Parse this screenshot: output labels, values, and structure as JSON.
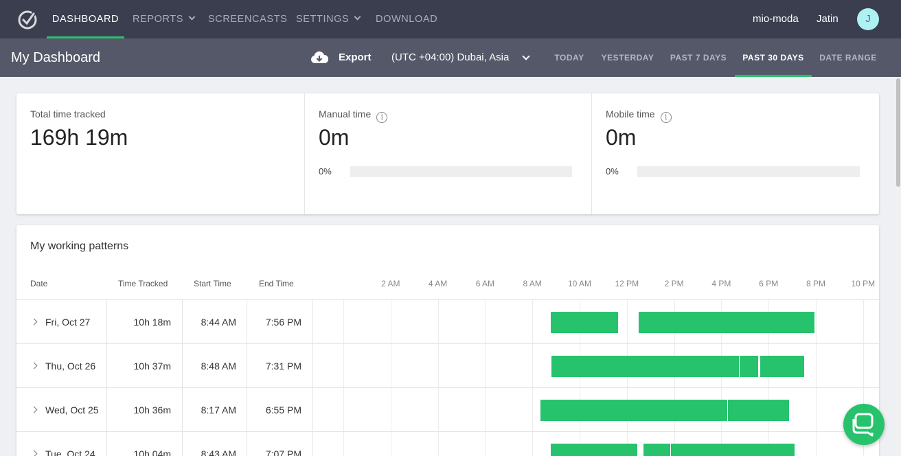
{
  "nav": {
    "items": [
      {
        "label": "DASHBOARD",
        "active": true,
        "dropdown": false
      },
      {
        "label": "REPORTS",
        "active": false,
        "dropdown": true
      },
      {
        "label": "SCREENCASTS",
        "active": false,
        "dropdown": false
      },
      {
        "label": "SETTINGS",
        "active": false,
        "dropdown": true
      },
      {
        "label": "DOWNLOAD",
        "active": false,
        "dropdown": false
      }
    ],
    "workspace": "mio-moda",
    "user": "Jatin",
    "avatar_initial": "J"
  },
  "subheader": {
    "title": "My Dashboard",
    "export_label": "Export",
    "timezone": "(UTC +04:00) Dubai, Asia",
    "ranges": [
      "TODAY",
      "YESTERDAY",
      "PAST 7 DAYS",
      "PAST 30 DAYS",
      "DATE RANGE"
    ],
    "active_range": "PAST 30 DAYS"
  },
  "stats": {
    "total": {
      "label": "Total time tracked",
      "value": "169h 19m"
    },
    "manual": {
      "label": "Manual time",
      "value": "0m",
      "percent_label": "0%",
      "percent": 0
    },
    "mobile": {
      "label": "Mobile time",
      "value": "0m",
      "percent_label": "0%",
      "percent": 0
    }
  },
  "patterns": {
    "title": "My working patterns",
    "columns": {
      "date": "Date",
      "tracked": "Time Tracked",
      "start": "Start Time",
      "end": "End Time"
    },
    "hour_labels": [
      "2 AM",
      "4 AM",
      "6 AM",
      "8 AM",
      "10 AM",
      "12 PM",
      "2 PM",
      "4 PM",
      "6 PM",
      "8 PM",
      "10 PM"
    ],
    "rows": [
      {
        "date": "Fri, Oct 27",
        "tracked": "10h 18m",
        "start": "8:44 AM",
        "end": "7:56 PM",
        "segments": [
          [
            8.77,
            11.63
          ],
          [
            12.5,
            19.93
          ]
        ]
      },
      {
        "date": "Thu, Oct 26",
        "tracked": "10h 37m",
        "start": "8:48 AM",
        "end": "7:31 PM",
        "segments": [
          [
            8.82,
            16.75
          ],
          [
            16.78,
            17.57
          ],
          [
            17.65,
            19.5
          ]
        ]
      },
      {
        "date": "Wed, Oct 25",
        "tracked": "10h 36m",
        "start": "8:17 AM",
        "end": "6:55 PM",
        "segments": [
          [
            8.33,
            16.25
          ],
          [
            16.28,
            18.87
          ]
        ]
      },
      {
        "date": "Tue, Oct 24",
        "tracked": "10h 04m",
        "start": "8:43 AM",
        "end": "7:07 PM",
        "segments": [
          [
            8.77,
            12.45
          ],
          [
            12.7,
            13.85
          ],
          [
            13.88,
            19.1
          ]
        ]
      }
    ]
  },
  "colors": {
    "accent": "#27c26c",
    "nav_bg": "#3b3e4f",
    "subheader_bg": "#545869"
  }
}
